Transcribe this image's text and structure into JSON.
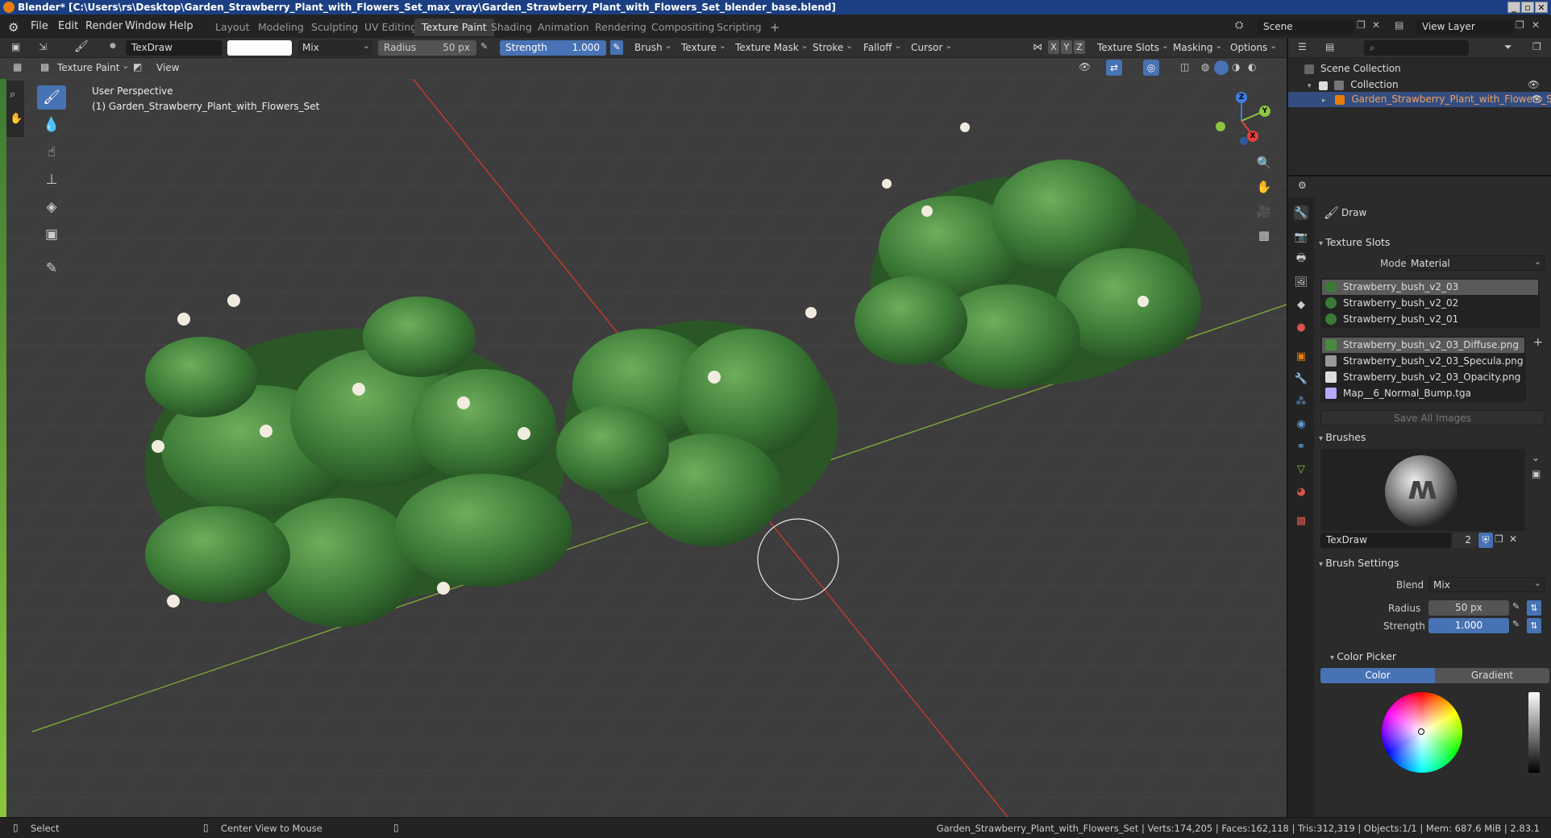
{
  "window": {
    "title": "Blender* [C:\\Users\\rs\\Desktop\\Garden_Strawberry_Plant_with_Flowers_Set_max_vray\\Garden_Strawberry_Plant_with_Flowers_Set_blender_base.blend]"
  },
  "menu": [
    "File",
    "Edit",
    "Render",
    "Window",
    "Help"
  ],
  "workspaces": [
    "Layout",
    "Modeling",
    "Sculpting",
    "UV Editing",
    "Texture Paint",
    "Shading",
    "Animation",
    "Rendering",
    "Compositing",
    "Scripting"
  ],
  "workspace_add": "+",
  "scene": {
    "name": "Scene",
    "view_layer": "View Layer"
  },
  "tool_header": {
    "brush_name": "TexDraw",
    "blend": "Mix",
    "radius_label": "Radius",
    "radius_value": "50 px",
    "strength_label": "Strength",
    "strength_value": "1.000",
    "menus": [
      "Brush",
      "Texture",
      "Texture Mask",
      "Stroke",
      "Falloff",
      "Cursor"
    ],
    "axes": [
      "X",
      "Y",
      "Z"
    ],
    "right_menus": [
      "Texture Slots",
      "Masking",
      "Options"
    ]
  },
  "viewport_header": {
    "mode": "Texture Paint",
    "view": "View"
  },
  "viewport": {
    "perspective": "User Perspective",
    "object": "(1) Garden_Strawberry_Plant_with_Flowers_Set"
  },
  "gizmo": {
    "x": "X",
    "y": "Y",
    "z": "Z"
  },
  "outliner": {
    "root": "Scene Collection",
    "collection": "Collection",
    "object": "Garden_Strawberry_Plant_with_Flowers_Set"
  },
  "properties": {
    "tool_name": "Draw",
    "texture_slots": {
      "title": "Texture Slots",
      "mode_label": "Mode",
      "mode_value": "Material",
      "materials": [
        "Strawberry_bush_v2_03",
        "Strawberry_bush_v2_02",
        "Strawberry_bush_v2_01"
      ],
      "images": [
        "Strawberry_bush_v2_03_Diffuse.png",
        "Strawberry_bush_v2_03_Specula.png",
        "Strawberry_bush_v2_03_Opacity.png",
        "Map__6_Normal_Bump.tga"
      ],
      "save_all": "Save All Images"
    },
    "brushes": {
      "title": "Brushes",
      "brush_name": "TexDraw",
      "users": "2"
    },
    "brush_settings": {
      "title": "Brush Settings",
      "blend_label": "Blend",
      "blend_value": "Mix",
      "radius_label": "Radius",
      "radius_value": "50 px",
      "strength_label": "Strength",
      "strength_value": "1.000",
      "color_picker": "Color Picker",
      "tab_color": "Color",
      "tab_gradient": "Gradient"
    }
  },
  "statusbar": {
    "select": "Select",
    "center": "Center View to Mouse",
    "stats": "Garden_Strawberry_Plant_with_Flowers_Set | Verts:174,205 | Faces:162,118 | Tris:312,319 | Objects:1/1 | Mem: 687.6 MiB | 2.83.1"
  },
  "colors": {
    "accent": "#4772b3",
    "title_bar": "#1b3f82",
    "leaf": "#3b7a36",
    "axis_x": "#c0392b",
    "axis_y": "#7aa33a"
  },
  "icons": [
    "blender-logo-icon",
    "brush-icon",
    "fill-icon",
    "smear-icon",
    "clone-icon",
    "mask-icon",
    "annotate-icon",
    "zoom-icon",
    "pan-icon",
    "camera-icon",
    "grid-icon",
    "eye-icon",
    "filter-icon",
    "search-icon"
  ]
}
